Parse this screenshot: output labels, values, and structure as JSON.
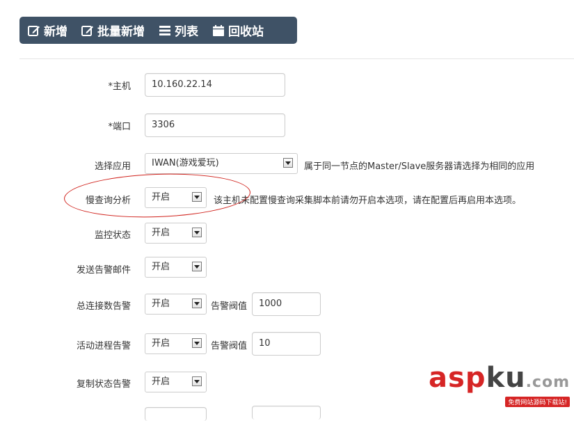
{
  "toolbar": {
    "buttons": [
      {
        "label": "新增",
        "icon": "edit-icon"
      },
      {
        "label": "批量新增",
        "icon": "edit-icon"
      },
      {
        "label": "列表",
        "icon": "list-icon"
      },
      {
        "label": "回收站",
        "icon": "calendar-icon"
      }
    ]
  },
  "form": {
    "host": {
      "label": "*主机",
      "value": "10.160.22.14"
    },
    "port": {
      "label": "*端口",
      "value": "3306"
    },
    "app": {
      "label": "选择应用",
      "value": "IWAN(游戏爱玩)",
      "help": "属于同一节点的Master/Slave服务器请选择为相同的应用"
    },
    "slow_query": {
      "label": "慢查询分析",
      "value": "开启",
      "help": "该主机未配置慢查询采集脚本前请勿开启本选项，请在配置后再启用本选项。"
    },
    "monitor": {
      "label": "监控状态",
      "value": "开启"
    },
    "alert_mail": {
      "label": "发送告警邮件",
      "value": "开启"
    },
    "conn_alert": {
      "label": "总连接数告警",
      "value": "开启",
      "threshold_label": "告警阀值",
      "threshold": "1000"
    },
    "proc_alert": {
      "label": "活动进程告警",
      "value": "开启",
      "threshold_label": "告警阀值",
      "threshold": "10"
    },
    "repl_alert": {
      "label": "复制状态告警",
      "value": "开启"
    }
  },
  "watermark": {
    "brand_a": "asp",
    "brand_b": "ku",
    "brand_c": ".com",
    "tagline": "免费网站源码下载站!"
  },
  "colors": {
    "toolbar_bg": "#3f5266",
    "highlight": "#d0201a",
    "watermark_red": "#d62525"
  }
}
